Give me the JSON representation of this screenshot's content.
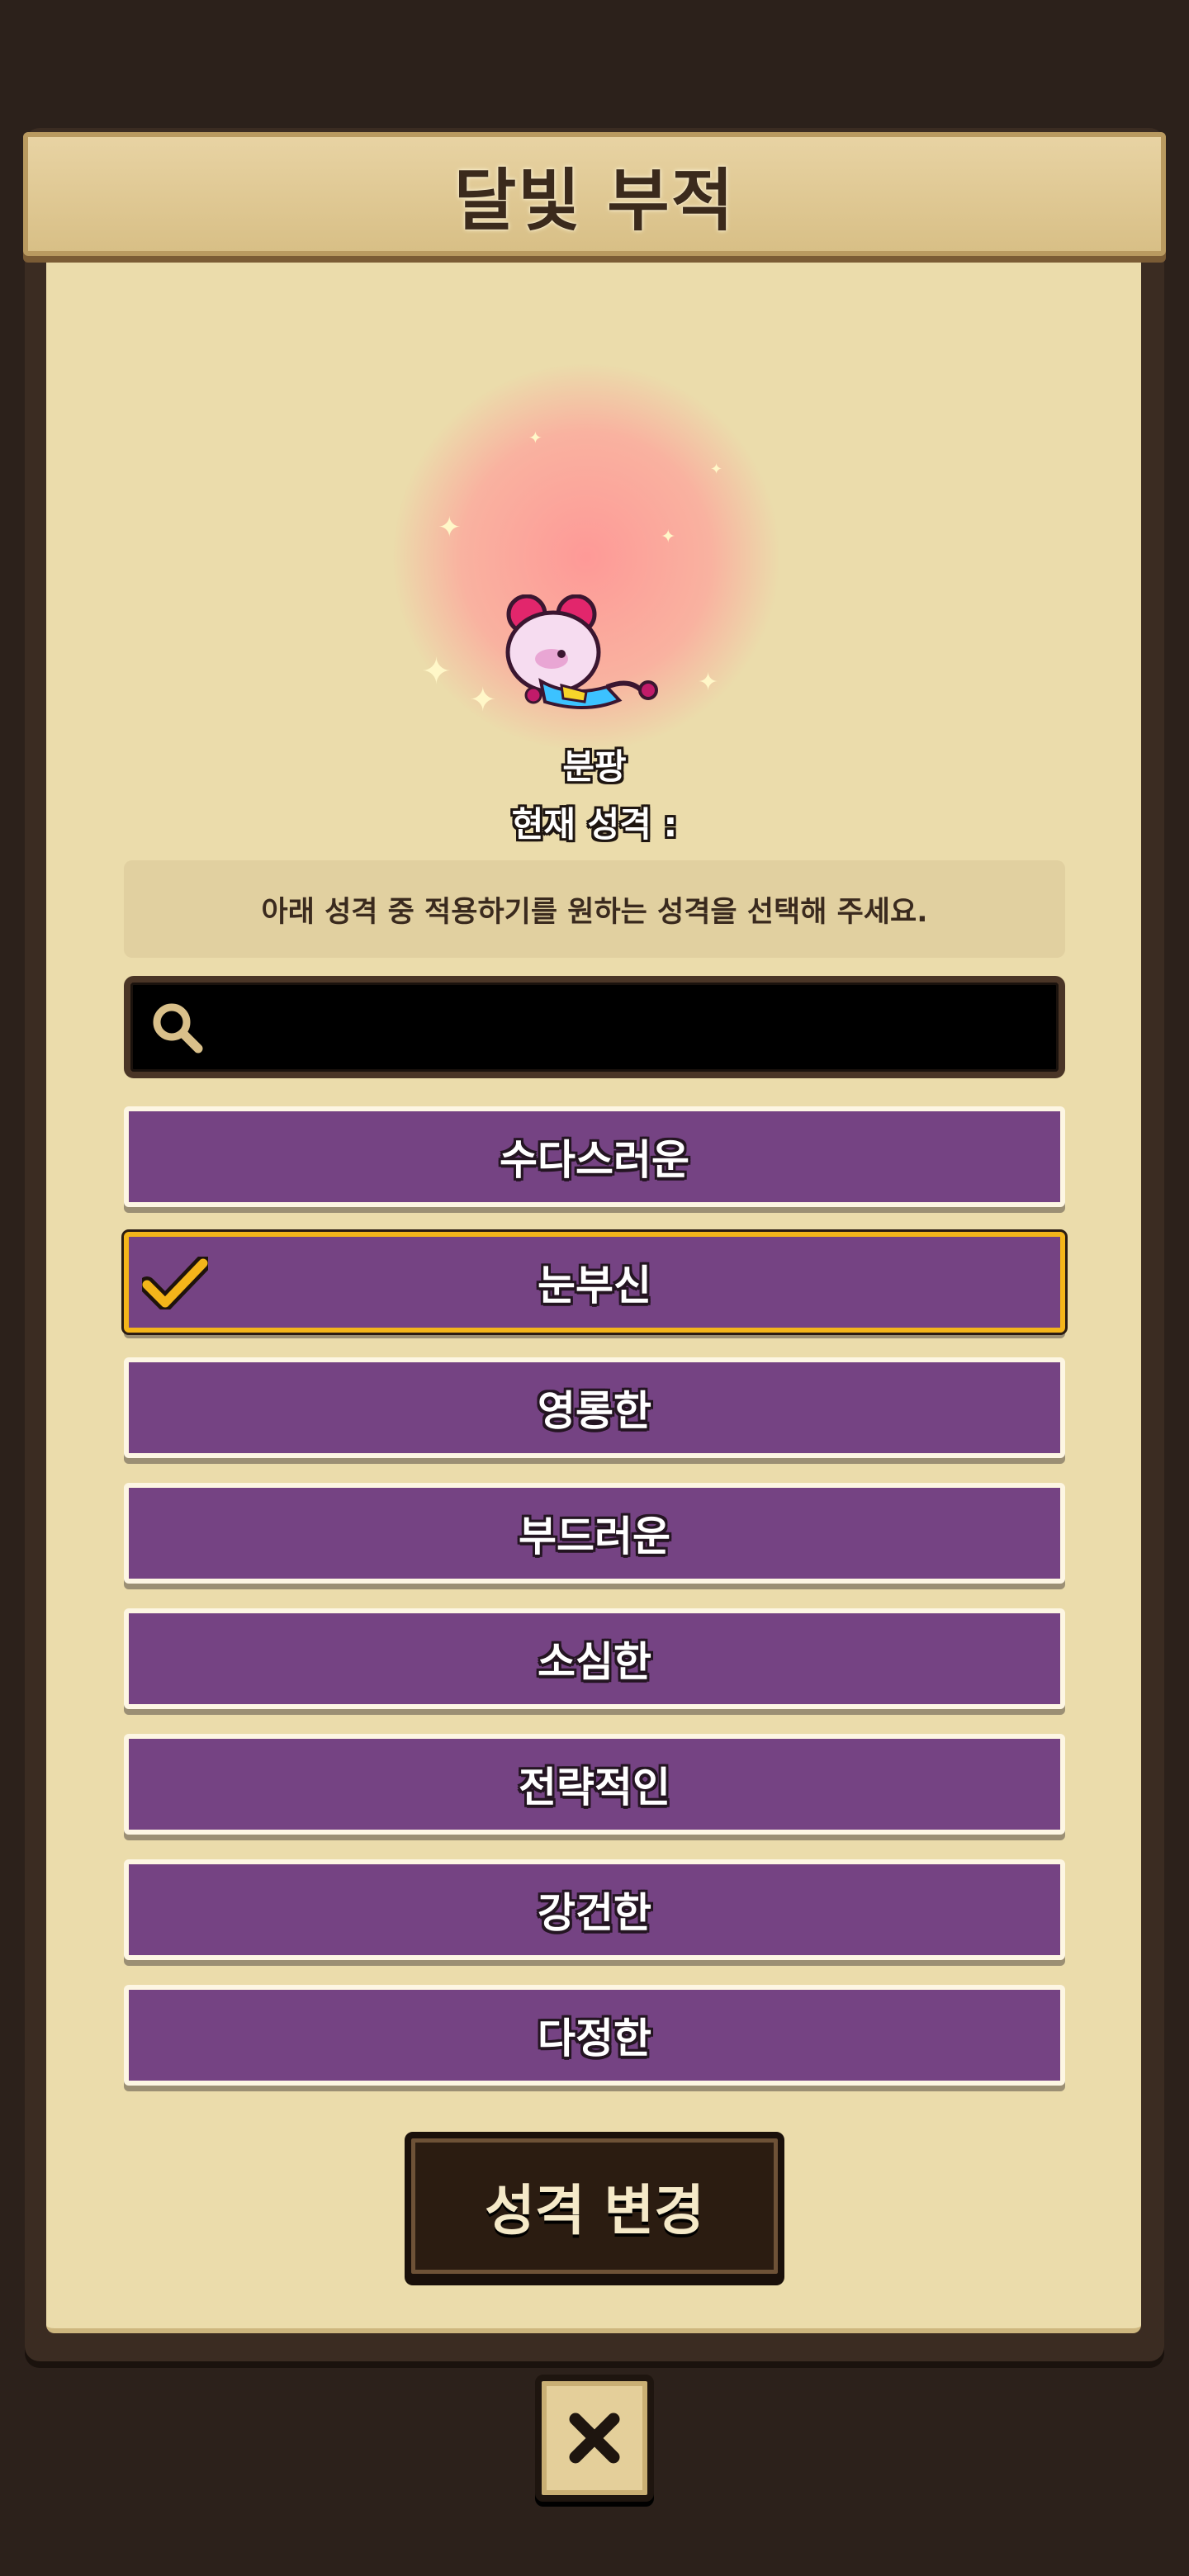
{
  "dialog": {
    "title": "달빛 부적"
  },
  "pet": {
    "name": "분팡",
    "current_trait_label": "현재 성격 :"
  },
  "instruction": "아래 성격 중 적용하기를 원하는 성격을 선택해 주세요.",
  "search": {
    "icon": "search-icon",
    "value": "",
    "placeholder": ""
  },
  "traits": [
    {
      "label": "수다스러운",
      "selected": false
    },
    {
      "label": "눈부신",
      "selected": true
    },
    {
      "label": "영롱한",
      "selected": false
    },
    {
      "label": "부드러운",
      "selected": false
    },
    {
      "label": "소심한",
      "selected": false
    },
    {
      "label": "전략적인",
      "selected": false
    },
    {
      "label": "강건한",
      "selected": false
    },
    {
      "label": "다정한",
      "selected": false
    }
  ],
  "actions": {
    "change_label": "성격 변경",
    "close_icon": "close-icon"
  },
  "colors": {
    "background": "#2c211b",
    "paper": "#ebdcab",
    "trait_purple": "#754383",
    "selected_border": "#f4b51a"
  }
}
